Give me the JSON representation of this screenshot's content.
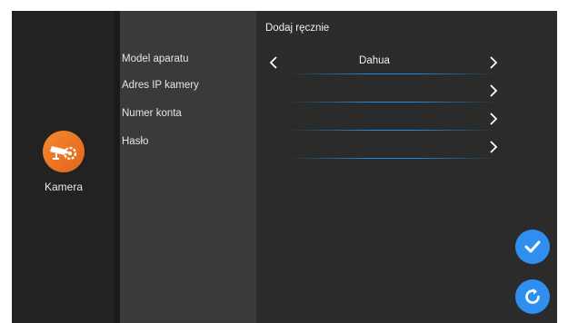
{
  "app": {
    "name": "Kamera",
    "icon": "camera-settings-icon",
    "accent": "#f07a24"
  },
  "form": {
    "title": "Dodaj ręcznie",
    "fields": [
      {
        "label": "Model aparatu",
        "value": "Dahua",
        "has_left_arrow": true
      },
      {
        "label": "Adres IP kamery",
        "value": ""
      },
      {
        "label": "Numer konta",
        "value": ""
      },
      {
        "label": "Hasło",
        "value": ""
      }
    ]
  },
  "actions": {
    "confirm_icon": "check-icon",
    "reset_icon": "refresh-icon",
    "color": "#2f8ff0"
  }
}
